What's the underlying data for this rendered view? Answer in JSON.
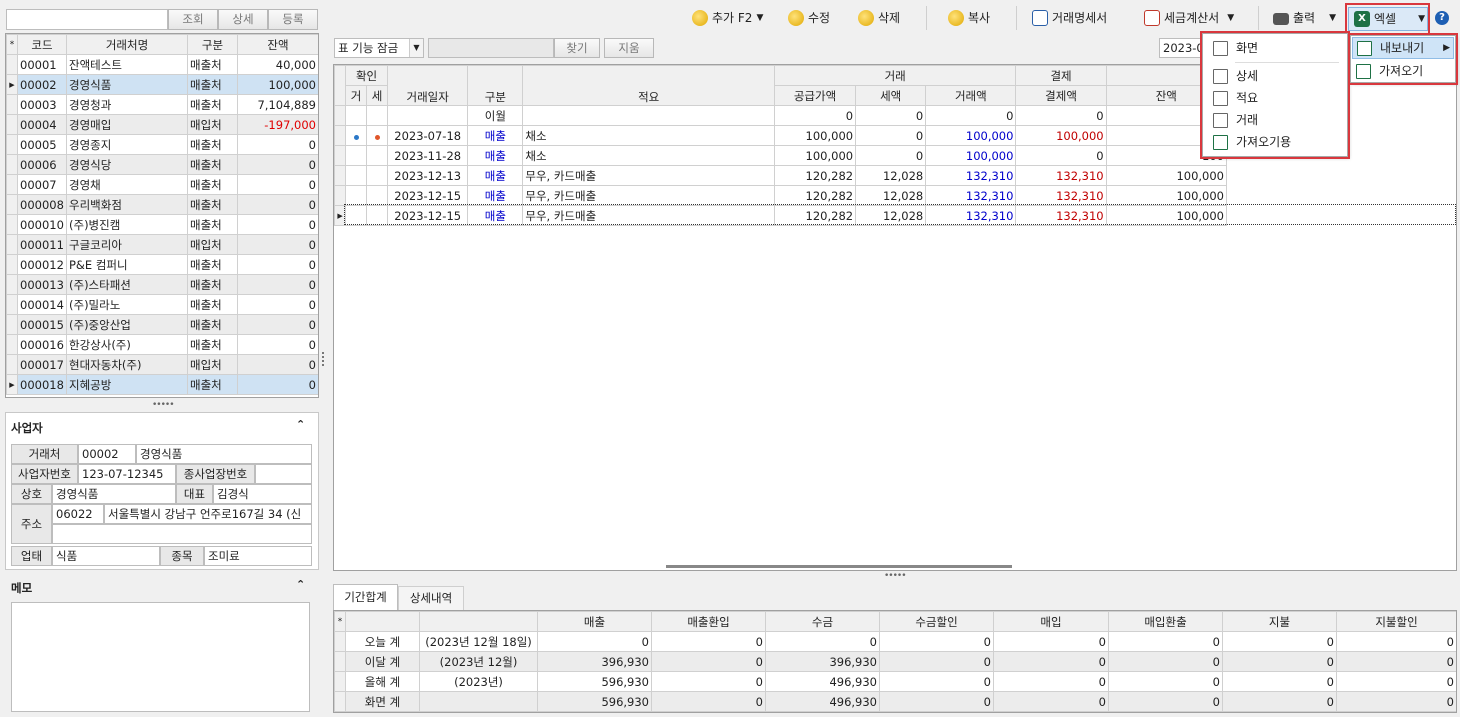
{
  "search": {
    "value": "",
    "find": "조회",
    "detail": "상세",
    "register": "등록"
  },
  "left_grid": {
    "headers": [
      "코드",
      "거래처명",
      "구분",
      "잔액"
    ],
    "rows": [
      {
        "code": "00001",
        "name": "잔액테스트",
        "type": "매출처",
        "bal": "40,000"
      },
      {
        "code": "00002",
        "name": "경영식품",
        "type": "매출처",
        "bal": "100,000"
      },
      {
        "code": "00003",
        "name": "경영청과",
        "type": "매출처",
        "bal": "7,104,889"
      },
      {
        "code": "00004",
        "name": "경영매입",
        "type": "매입처",
        "bal": "-197,000"
      },
      {
        "code": "00005",
        "name": "경영종지",
        "type": "매출처",
        "bal": "0"
      },
      {
        "code": "00006",
        "name": "경영식당",
        "type": "매출처",
        "bal": "0"
      },
      {
        "code": "00007",
        "name": "경영채",
        "type": "매출처",
        "bal": "0"
      },
      {
        "code": "000008",
        "name": "우리백화점",
        "type": "매출처",
        "bal": "0"
      },
      {
        "code": "000010",
        "name": "(주)병진캠",
        "type": "매출처",
        "bal": "0"
      },
      {
        "code": "000011",
        "name": "구글코리아",
        "type": "매입처",
        "bal": "0"
      },
      {
        "code": "000012",
        "name": "P&E 컴퍼니",
        "type": "매출처",
        "bal": "0"
      },
      {
        "code": "000013",
        "name": "(주)스타패션",
        "type": "매출처",
        "bal": "0"
      },
      {
        "code": "000014",
        "name": "(주)밀라노",
        "type": "매출처",
        "bal": "0"
      },
      {
        "code": "000015",
        "name": "(주)중앙산업",
        "type": "매출처",
        "bal": "0"
      },
      {
        "code": "000016",
        "name": "한강상사(주)",
        "type": "매출처",
        "bal": "0"
      },
      {
        "code": "000017",
        "name": "현대자동차(주)",
        "type": "매입처",
        "bal": "0"
      },
      {
        "code": "000018",
        "name": "지혜공방",
        "type": "매출처",
        "bal": "0"
      }
    ]
  },
  "business": {
    "title": "사업자",
    "client_label": "거래처",
    "client_code": "00002",
    "client_name": "경영식품",
    "bizno_label": "사업자번호",
    "bizno": "123-07-12345",
    "subbiz_label": "종사업장번호",
    "subbiz": "",
    "company_label": "상호",
    "company": "경영식품",
    "ceo_label": "대표",
    "ceo": "김경식",
    "addr_label": "주소",
    "zip": "06022",
    "addr": "서울특별시 강남구 언주로167길 34 (신",
    "addr2": "",
    "biztype_label": "업태",
    "biztype": "식품",
    "item_label": "종목",
    "item": "조미료"
  },
  "memo": {
    "title": "메모",
    "text": ""
  },
  "toolbar": {
    "add": "추가 F2",
    "edit": "수정",
    "delete": "삭제",
    "copy": "복사",
    "statement": "거래명세서",
    "tax": "세금계산서",
    "print": "출력",
    "excel": "엑셀"
  },
  "filter": {
    "lock": "표 기능 잠금",
    "find": "찾기",
    "clear": "지움",
    "date": "2023-0"
  },
  "main_grid": {
    "group_confirm": "확인",
    "group_trade": "거래",
    "group_pay": "결제",
    "h_g": "거",
    "h_s": "세",
    "h_date": "거래일자",
    "h_type": "구분",
    "h_memo": "적요",
    "h_supply": "공급가액",
    "h_tax": "세액",
    "h_amount": "거래액",
    "h_payamt": "결제액",
    "h_bal": "잔액",
    "rows": [
      {
        "date": "",
        "type": "이월",
        "memo": "",
        "supply": "0",
        "tax": "0",
        "amount": "0",
        "pay": "0",
        "bal": ""
      },
      {
        "date": "2023-07-18",
        "type": "매출",
        "memo": "채소",
        "supply": "100,000",
        "tax": "0",
        "amount": "100,000",
        "pay": "100,000",
        "bal": ""
      },
      {
        "date": "2023-11-28",
        "type": "매출",
        "memo": "채소",
        "supply": "100,000",
        "tax": "0",
        "amount": "100,000",
        "pay": "0",
        "bal": "100"
      },
      {
        "date": "2023-12-13",
        "type": "매출",
        "memo": "무우, 카드매출",
        "supply": "120,282",
        "tax": "12,028",
        "amount": "132,310",
        "pay": "132,310",
        "bal": "100,000"
      },
      {
        "date": "2023-12-15",
        "type": "매출",
        "memo": "무우, 카드매출",
        "supply": "120,282",
        "tax": "12,028",
        "amount": "132,310",
        "pay": "132,310",
        "bal": "100,000"
      },
      {
        "date": "2023-12-15",
        "type": "매출",
        "memo": "무우, 카드매출",
        "supply": "120,282",
        "tax": "12,028",
        "amount": "132,310",
        "pay": "132,310",
        "bal": "100,000"
      }
    ]
  },
  "excel_menu": {
    "items": [
      "화면",
      "상세",
      "적요",
      "거래",
      "가져오기용"
    ]
  },
  "excel_submenu": {
    "items": [
      "내보내기",
      "가져오기"
    ]
  },
  "tabs": [
    "기간합계",
    "상세내역"
  ],
  "summary": {
    "headers": [
      "매출",
      "매출환입",
      "수금",
      "수금할인",
      "매입",
      "매입환출",
      "지불",
      "지불할인"
    ],
    "rows": [
      {
        "label": "오늘 계",
        "period": "(2023년 12월 18일)",
        "vals": [
          "0",
          "0",
          "0",
          "0",
          "0",
          "0",
          "0",
          "0"
        ]
      },
      {
        "label": "이달 계",
        "period": "(2023년 12월)",
        "vals": [
          "396,930",
          "0",
          "396,930",
          "0",
          "0",
          "0",
          "0",
          "0"
        ]
      },
      {
        "label": "올해 계",
        "period": "(2023년)",
        "vals": [
          "596,930",
          "0",
          "496,930",
          "0",
          "0",
          "0",
          "0",
          "0"
        ]
      },
      {
        "label": "화면 계",
        "period": "",
        "vals": [
          "596,930",
          "0",
          "496,930",
          "0",
          "0",
          "0",
          "0",
          "0"
        ]
      }
    ]
  }
}
